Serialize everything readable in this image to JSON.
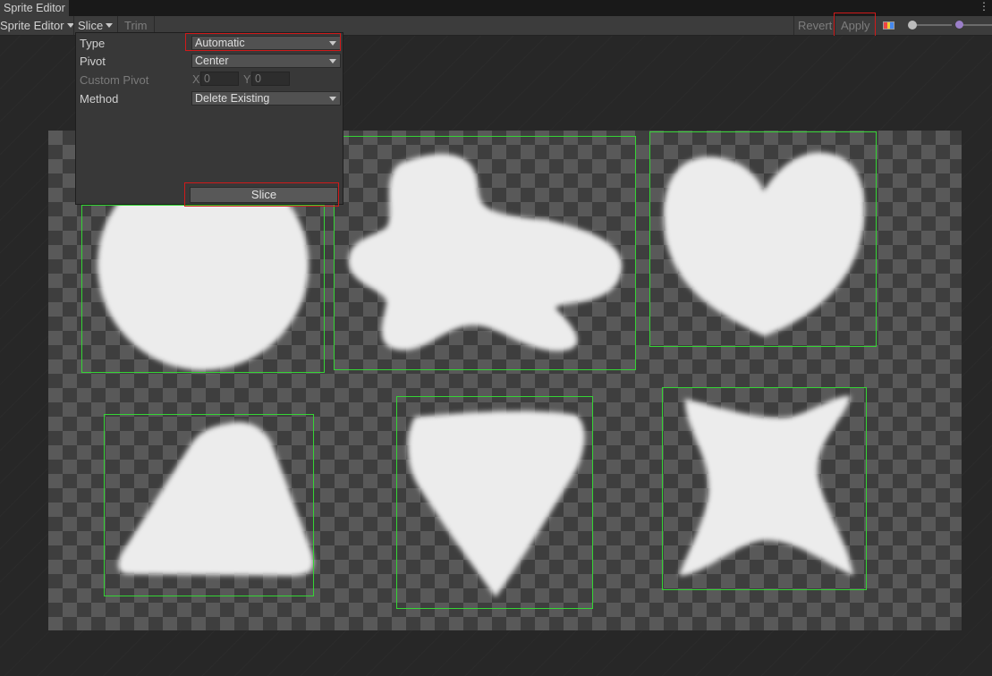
{
  "window": {
    "tab_title": "Sprite Editor"
  },
  "toolbar": {
    "mode_label": "Sprite Editor",
    "slice_label": "Slice",
    "trim_label": "Trim",
    "revert_label": "Revert",
    "apply_label": "Apply"
  },
  "slice_popup": {
    "type_label": "Type",
    "type_value": "Automatic",
    "pivot_label": "Pivot",
    "pivot_value": "Center",
    "custom_pivot_label": "Custom Pivot",
    "x_label": "X",
    "x_value": "0",
    "y_label": "Y",
    "y_value": "0",
    "method_label": "Method",
    "method_value": "Delete Existing",
    "slice_button_label": "Slice"
  },
  "sprites": [
    "circle",
    "flower",
    "heart",
    "triangle",
    "shield",
    "star"
  ],
  "colors": {
    "highlight": "#d01a1a",
    "sprite_outline": "#35d435",
    "sprite_fill": "#eeeeee"
  },
  "icons": [
    "rgb-channel-icon",
    "zoom-slider",
    "mip-slider",
    "menu-kebab-icon"
  ]
}
